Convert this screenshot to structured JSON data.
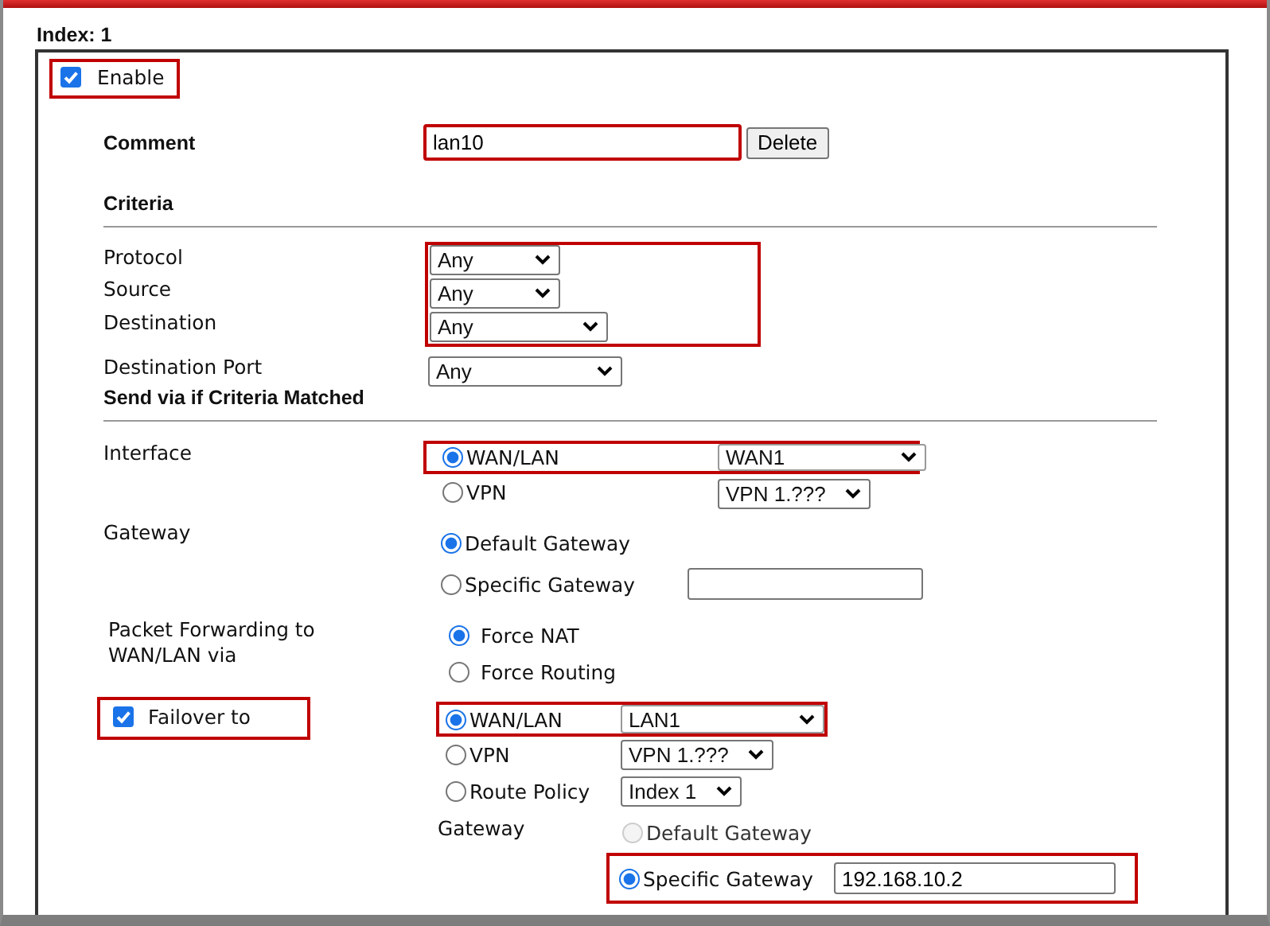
{
  "index_label": "Index: 1",
  "enable": {
    "label": "Enable",
    "checked": true,
    "highlighted": true
  },
  "comment": {
    "label": "Comment",
    "value": "lan10",
    "highlighted": true,
    "button": "Delete"
  },
  "criteria": {
    "heading": "Criteria",
    "fields": [
      {
        "label": "Protocol",
        "value": "Any",
        "highlighted": true
      },
      {
        "label": "Source",
        "value": "Any",
        "highlighted": true
      },
      {
        "label": "Destination",
        "value": "Any",
        "highlighted": true
      },
      {
        "label": "Destination Port",
        "value": "Any",
        "highlighted": false
      }
    ]
  },
  "send_via": {
    "heading": "Send via if Criteria Matched",
    "interface": {
      "label": "Interface",
      "options": [
        {
          "label": "WAN/LAN",
          "selected": true,
          "dropdown": "WAN1",
          "highlighted": true
        },
        {
          "label": "VPN",
          "selected": false,
          "dropdown": "VPN 1.???",
          "highlighted": false
        }
      ]
    },
    "gateway": {
      "label": "Gateway",
      "options": [
        {
          "label": "Default Gateway",
          "selected": true,
          "kind": "plain",
          "disabled": false,
          "highlighted": false
        },
        {
          "label": "Specific Gateway",
          "selected": false,
          "kind": "field",
          "disabled": false,
          "highlighted": false
        }
      ]
    },
    "packet_forwarding": {
      "label": "Packet Forwarding to WAN/LAN via",
      "options": [
        {
          "label": "Force NAT",
          "selected": true
        },
        {
          "label": "Force Routing",
          "selected": false
        }
      ]
    },
    "failover": {
      "label": "Failover to",
      "checked": true,
      "highlighted": true,
      "options": [
        {
          "label": "WAN/LAN",
          "selected": true,
          "dropdown": "LAN1",
          "highlighted": true
        },
        {
          "label": "VPN",
          "selected": false,
          "dropdown": "VPN 1.???",
          "highlighted": false
        },
        {
          "label": "Route Policy",
          "selected": false,
          "dropdown": "Index 1",
          "highlighted": false
        }
      ],
      "gateway": {
        "label": "Gateway",
        "options": [
          {
            "label": "Default Gateway",
            "selected": false,
            "kind": "plain",
            "disabled": true,
            "highlighted": false
          },
          {
            "label": "Specific Gateway",
            "selected": true,
            "kind": "field",
            "value": "192.168.10.2",
            "disabled": false,
            "highlighted": true
          }
        ]
      }
    }
  }
}
